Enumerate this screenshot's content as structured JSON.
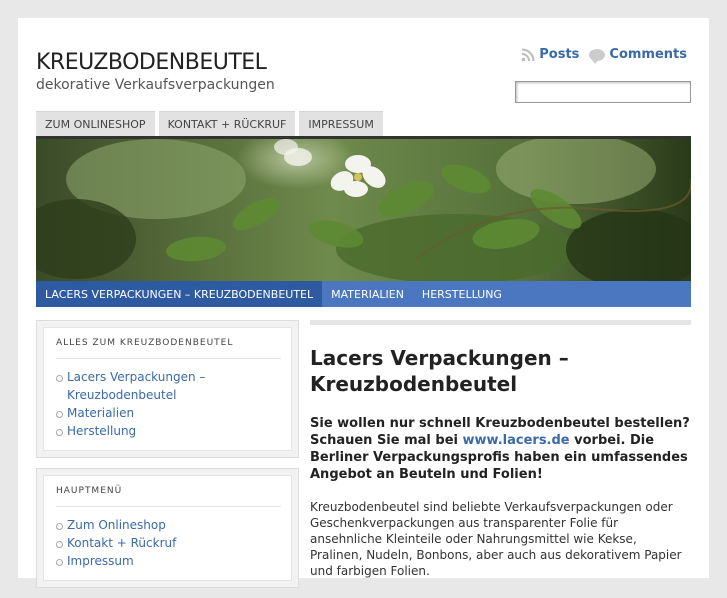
{
  "site": {
    "title": "KREUZBODENBEUTEL",
    "description": "dekorative Verkaufsverpackungen"
  },
  "feeds": {
    "posts_label": "Posts",
    "comments_label": "Comments"
  },
  "search": {
    "value": ""
  },
  "top_nav": {
    "items": [
      {
        "label": "ZUM ONLINESHOP"
      },
      {
        "label": "KONTAKT + RÜCKRUF"
      },
      {
        "label": "IMPRESSUM"
      }
    ]
  },
  "sub_nav": {
    "items": [
      {
        "label": "LACERS VERPACKUNGEN – KREUZBODENBEUTEL",
        "active": true
      },
      {
        "label": "MATERIALIEN"
      },
      {
        "label": "HERSTELLUNG"
      }
    ]
  },
  "sidebar": {
    "widget1": {
      "title": "ALLES ZUM KREUZBODENBEUTEL",
      "items": [
        {
          "label": "Lacers Verpackungen – Kreuzbodenbeutel"
        },
        {
          "label": "Materialien"
        },
        {
          "label": "Herstellung"
        }
      ]
    },
    "widget2": {
      "title": "HAUPTMENÜ",
      "items": [
        {
          "label": "Zum Onlineshop"
        },
        {
          "label": "Kontakt + Rückruf"
        },
        {
          "label": "Impressum"
        }
      ]
    }
  },
  "post": {
    "title": "Lacers Verpackungen – Kreuzbodenbeutel",
    "lead_before": "Sie wollen nur schnell Kreuzbodenbeutel bestellen? Schauen Sie mal bei ",
    "lead_link": "www.lacers.de",
    "lead_after": " vorbei. Die Berliner Verpackungsprofis haben ein umfassendes Angebot an Beuteln und Folien!",
    "body": "Kreuzbodenbeutel sind beliebte Verkaufsverpackungen oder Geschenkverpackungen aus transparenter Folie für ansehnliche Kleinteile oder Nahrungsmittel wie Kekse, Pralinen, Nudeln, Bonbons, aber auch aus dekorativem Papier und farbigen Folien."
  },
  "colors": {
    "link": "#3a6aa8",
    "sub_nav_bg": "#4a77c0",
    "sub_nav_active": "#2d5aa0"
  }
}
